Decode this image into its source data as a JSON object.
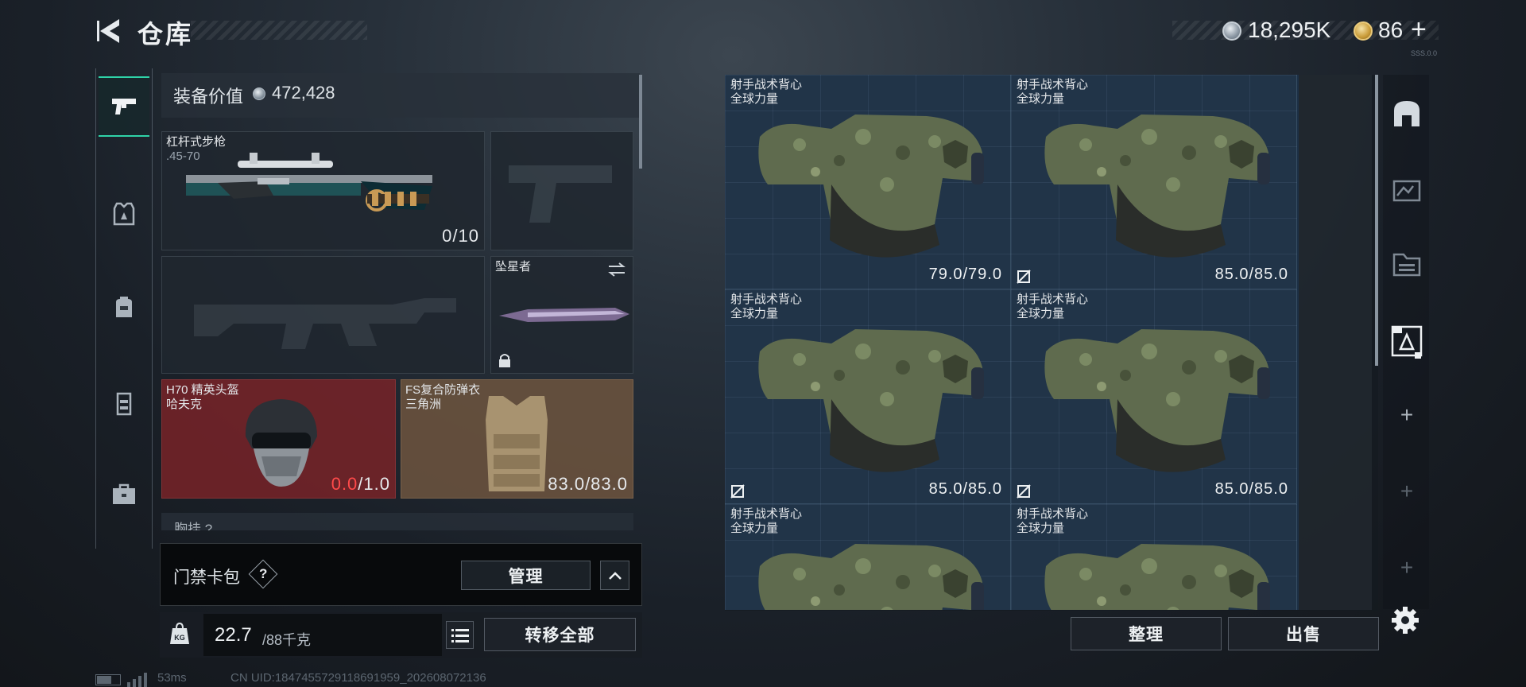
{
  "header": {
    "title": "仓库",
    "currency_silver": "18,295K",
    "currency_gold": "86",
    "currency_plus": "+",
    "fps": "SSS.0.0"
  },
  "loadout": {
    "value_label": "装备价值",
    "value": "472,428",
    "rifle": {
      "name": "杠杆式步枪",
      "caliber": ".45-70",
      "ammo": "0/10"
    },
    "melee": {
      "name": "坠星者"
    },
    "helmet": {
      "name": "H70 精英头盔",
      "brand": "哈夫克",
      "durability_current": "0.0",
      "durability_max": "/1.0"
    },
    "armor": {
      "name": "FS复合防弹衣",
      "brand": "三角洲",
      "durability": "83.0/83.0"
    },
    "chest_rig_label": "胸挂",
    "chest_rig_hint": "?"
  },
  "cardbag": {
    "label": "门禁卡包",
    "help": "?",
    "manage": "管理"
  },
  "weight": {
    "value": "22.7",
    "max": "/88千克"
  },
  "transfer_all": "转移全部",
  "stash": {
    "items": [
      {
        "name": "射手战术背心",
        "brand": "全球力量",
        "durability": "79.0/79.0",
        "flagged": false
      },
      {
        "name": "射手战术背心",
        "brand": "全球力量",
        "durability": "85.0/85.0",
        "flagged": true
      },
      {
        "name": "射手战术背心",
        "brand": "全球力量",
        "durability": "85.0/85.0",
        "flagged": true
      },
      {
        "name": "射手战术背心",
        "brand": "全球力量",
        "durability": "85.0/85.0",
        "flagged": true
      },
      {
        "name": "射手战术背心",
        "brand": "全球力量",
        "durability": "",
        "flagged": false
      },
      {
        "name": "射手战术背心",
        "brand": "全球力量",
        "durability": "",
        "flagged": false
      }
    ],
    "sort": "整理",
    "sell": "出售"
  },
  "footer": {
    "ping": "53ms",
    "uid": "CN UID:1847455729118691959_202608072136"
  },
  "colors": {
    "accent": "#2fd3a8",
    "helmet_slot": "#782328",
    "armor_slot": "#69523e",
    "broken": "#ff4a4a"
  }
}
